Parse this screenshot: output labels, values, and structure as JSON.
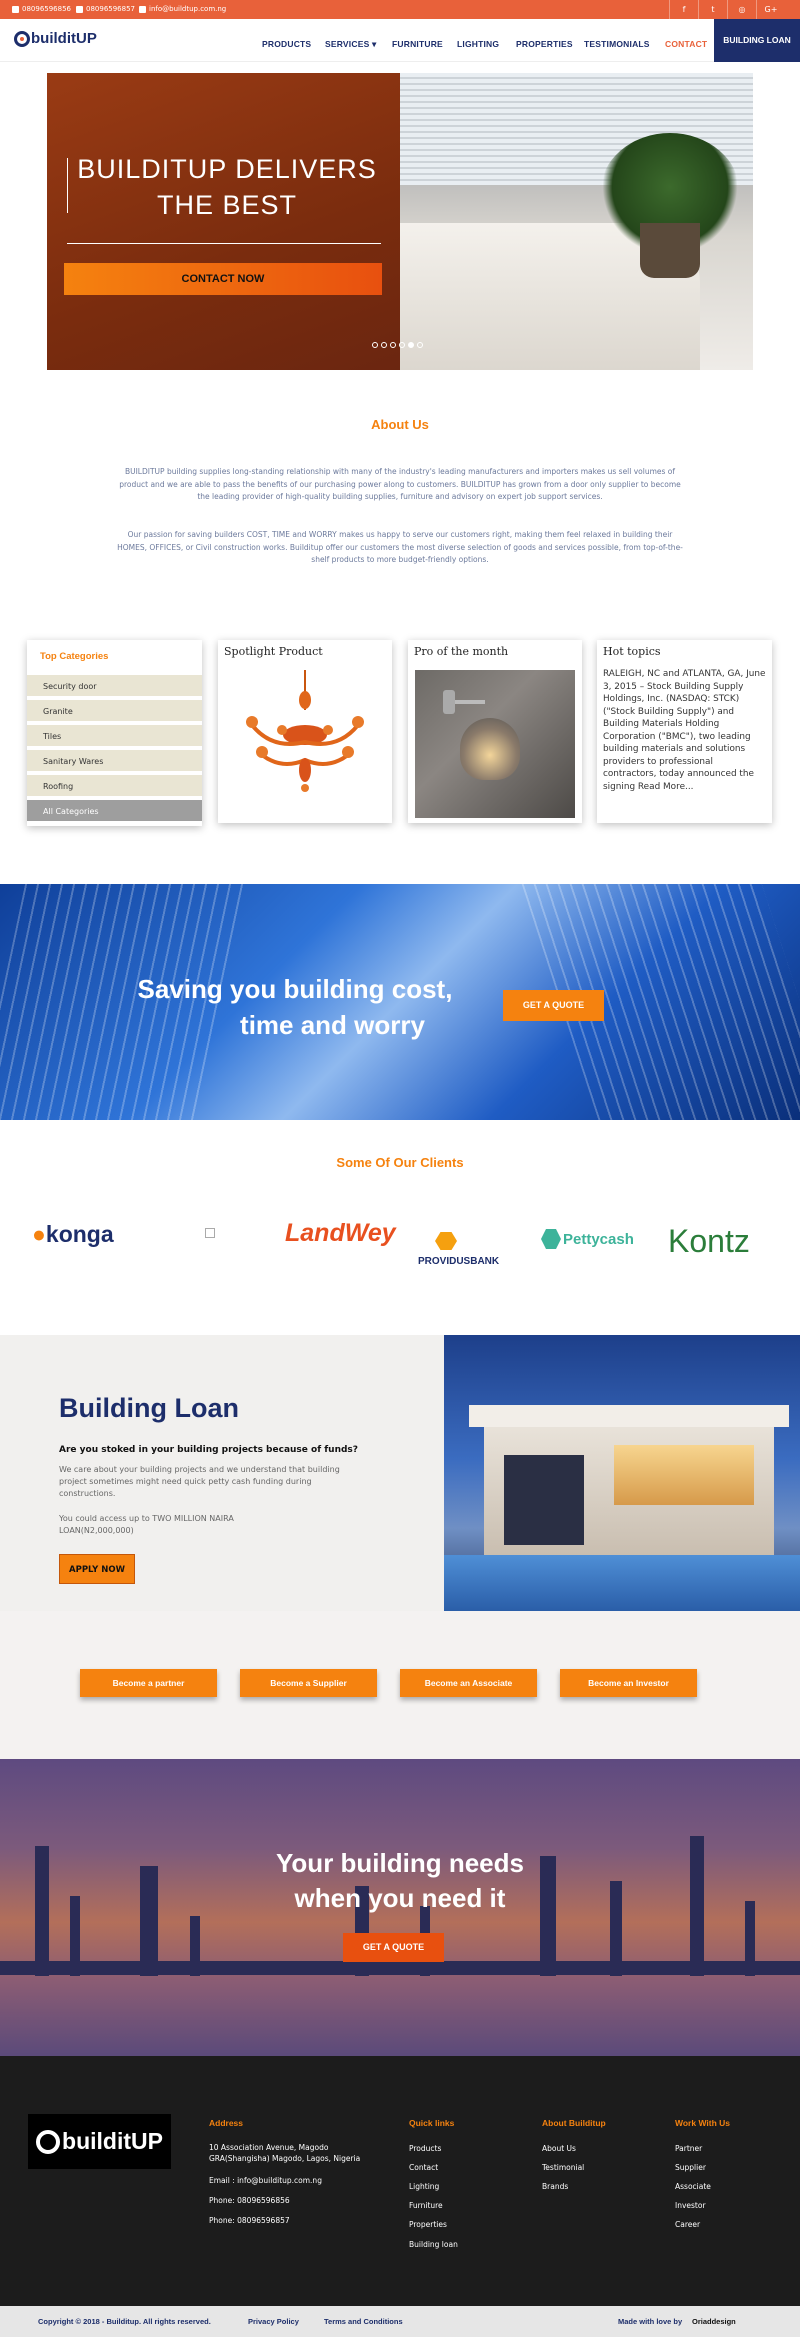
{
  "topbar": {
    "phone1": "08096596856",
    "phone2": "08096596857",
    "email": "info@buildtup.com.ng",
    "social": [
      "f",
      "t",
      "ig",
      "G+"
    ]
  },
  "nav": {
    "logo": "builditUP",
    "items": [
      "PRODUCTS",
      "SERVICES ▾",
      "FURNITURE",
      "LIGHTING",
      "PROPERTIES",
      "TESTIMONIALS",
      "CONTACT"
    ],
    "loan_button": "BUILDING LOAN"
  },
  "hero": {
    "title_line1": "BUILDITUP DELIVERS",
    "title_line2": "THE BEST",
    "cta": "CONTACT NOW",
    "slide_count": 6,
    "active_slide": 5
  },
  "about": {
    "title": "About Us",
    "p1": "BUILDITUP building supplies long-standing relationship with many of the industry's leading manufacturers and importers makes us sell volumes of product and we are able to pass the benefits of our purchasing power along to customers. BUILDITUP has grown from a door only supplier to become the leading provider of high-quality building supplies, furniture and advisory on expert job support services.",
    "p2": "Our passion for saving builders COST, TIME and WORRY makes us happy to serve our customers right, making them feel relaxed in building their HOMES, OFFICES, or Civil construction works. Builditup offer our customers the most diverse selection of goods and services possible, from top-of-the-shelf products to more budget-friendly options."
  },
  "categories": {
    "title": "Top Categories",
    "items": [
      "Security door",
      "Granite",
      "Tiles",
      "Sanitary Wares",
      "Roofing",
      "All Categories"
    ]
  },
  "cards": {
    "spotlight": "Spotlight Product",
    "pro": "Pro of the month",
    "hot_title": "Hot topics",
    "hot_text": "RALEIGH, NC and ATLANTA, GA, June 3, 2015 – Stock Building Supply Holdings, Inc. (NASDAQ: STCK) (\"Stock Building Supply\") and Building Materials Holding Corporation (\"BMC\"), two leading building materials and solutions providers to professional contractors, today announced the signing",
    "read_more": "Read More..."
  },
  "banner": {
    "line1": "Saving you building cost,",
    "line2": "time and worry",
    "cta": "GET A QUOTE"
  },
  "clients": {
    "title": "Some Of Our Clients",
    "names": [
      "konga",
      "LandWey",
      "PROVIDUSBANK",
      "Pettycash",
      "Kontz"
    ]
  },
  "loan": {
    "title": "Building Loan",
    "question": "Are you stoked in your building projects because of funds?",
    "p1": "We care about your building projects and we understand that building project sometimes might need quick petty cash funding during constructions.",
    "p2": "You could access up to TWO MILLION NAIRA LOAN(N2,000,000)",
    "cta": "APPLY NOW"
  },
  "partners": [
    "Become a partner",
    "Become a Supplier",
    "Become an Associate",
    "Become an Investor"
  ],
  "sunset": {
    "line1": "Your building needs",
    "line2": "when you need it",
    "cta": "GET A QUOTE"
  },
  "footer": {
    "logo": "builditUP",
    "address_title": "Address",
    "address": "10 Association Avenue, Magodo GRA(Shangisha) Magodo, Lagos, Nigeria",
    "email": "Email : info@builditup.com.ng",
    "phone1": "Phone: 08096596856",
    "phone2": "Phone: 08096596857",
    "quick_title": "Quick links",
    "quick": [
      "Products",
      "Contact",
      "Lighting",
      "Furniture",
      "Properties",
      "Building loan"
    ],
    "about_title": "About Builditup",
    "about": [
      "About Us",
      "Testimonial",
      "Brands"
    ],
    "work_title": "Work With Us",
    "work": [
      "Partner",
      "Supplier",
      "Associate",
      "Investor",
      "Career"
    ]
  },
  "bottom": {
    "copyright": "Copyright © 2018 - Builditup. All rights reserved.",
    "privacy": "Privacy Policy",
    "terms": "Terms and Conditions",
    "made": "Made with love by",
    "maker": "Oriaddesign"
  },
  "colors": {
    "brand_orange": "#f5820f",
    "topbar": "#e8613a",
    "navy": "#1d2e6b"
  }
}
